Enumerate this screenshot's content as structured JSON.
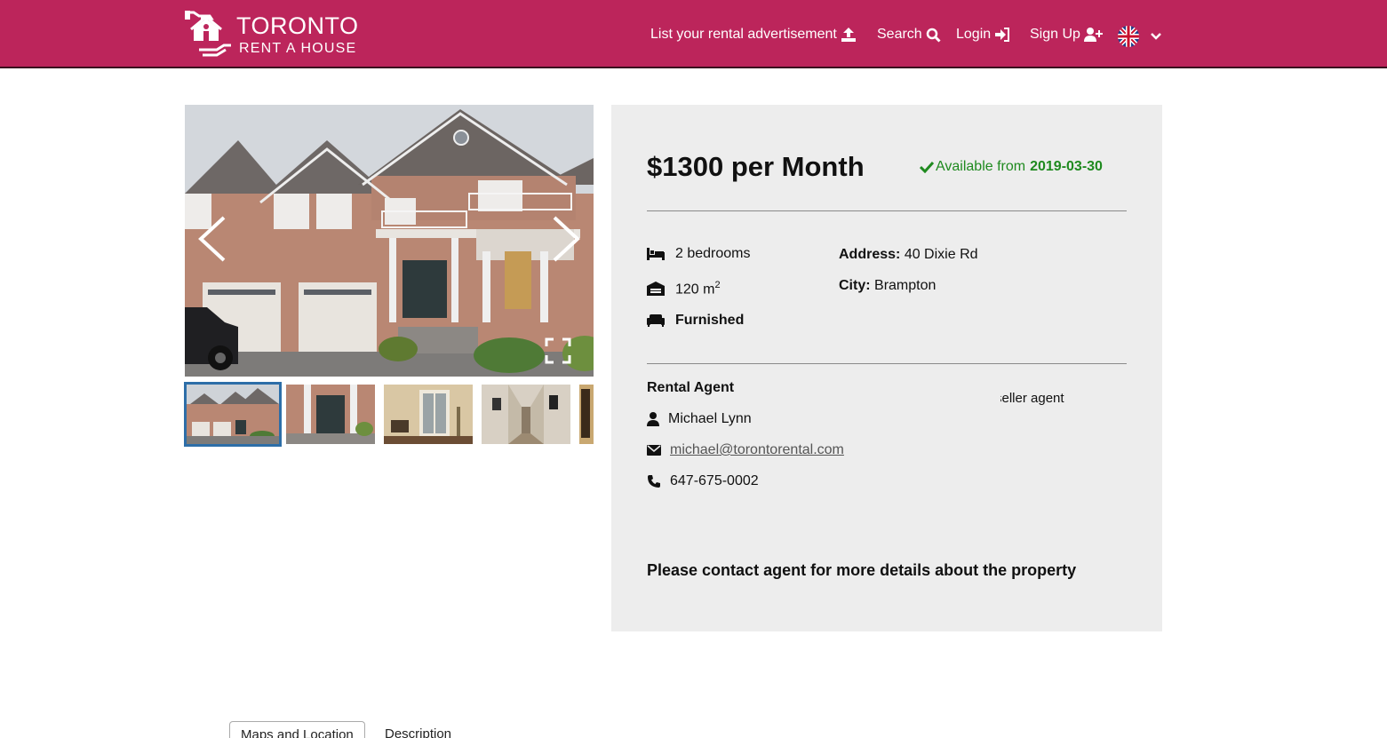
{
  "header": {
    "logo_title": "TORONTO",
    "logo_subtitle": "RENT A HOUSE",
    "nav": {
      "list_ad": "List your rental advertisement",
      "search": "Search",
      "login": "Login",
      "signup": "Sign Up"
    },
    "language_icon": "uk-flag-icon"
  },
  "gallery": {
    "thumbnail_count": 5,
    "active_thumbnail": 1
  },
  "listing": {
    "price": "$1300 per Month",
    "available_label": "Available from",
    "available_date": "2019-03-30",
    "bedrooms": "2 bedrooms",
    "area": "120 m",
    "area_unit_sup": "2",
    "furnished": "Furnished",
    "address_label": "Address:",
    "address_value": "40 Dixie Rd",
    "city_label": "City:",
    "city_value": "Brampton"
  },
  "agent": {
    "section_title": "Rental Agent",
    "name": "Michael Lynn",
    "email": "michael@torontorental.com",
    "phone": "647-675-0002",
    "seller_badge": "seller agent"
  },
  "contact_note": "Please contact agent for more details about the property",
  "tabs": [
    {
      "label": "Maps and Location"
    },
    {
      "label": "Description"
    }
  ],
  "colors": {
    "brand": "#bc255b",
    "available_green": "#1f8a1f",
    "panel_bg": "#ededed",
    "thumb_border": "#2d6ea8"
  }
}
